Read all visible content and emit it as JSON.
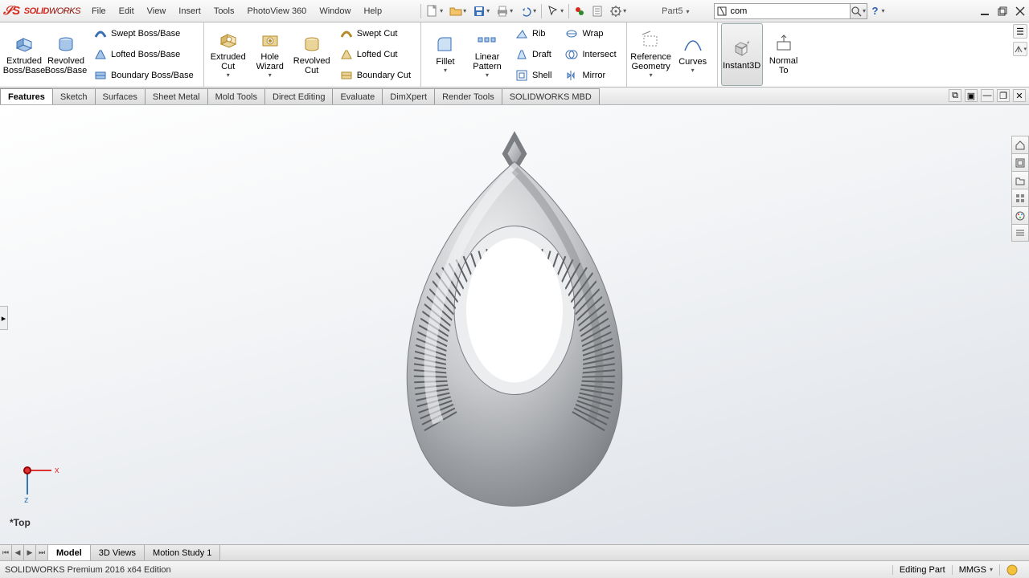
{
  "title": {
    "doc": "Part5",
    "search_value": "com"
  },
  "menus": [
    "File",
    "Edit",
    "View",
    "Insert",
    "Tools",
    "PhotoView 360",
    "Window",
    "Help"
  ],
  "ribbon": {
    "extruded_boss": "Extruded Boss/Base",
    "revolved_boss": "Revolved Boss/Base",
    "swept_boss": "Swept Boss/Base",
    "lofted_boss": "Lofted Boss/Base",
    "boundary_boss": "Boundary Boss/Base",
    "extruded_cut": "Extruded Cut",
    "hole_wizard": "Hole Wizard",
    "revolved_cut": "Revolved Cut",
    "swept_cut": "Swept Cut",
    "lofted_cut": "Lofted Cut",
    "boundary_cut": "Boundary Cut",
    "fillet": "Fillet",
    "linear_pattern": "Linear Pattern",
    "rib": "Rib",
    "draft": "Draft",
    "shell": "Shell",
    "wrap": "Wrap",
    "intersect": "Intersect",
    "mirror": "Mirror",
    "reference_geometry": "Reference Geometry",
    "curves": "Curves",
    "instant3d": "Instant3D",
    "normal_to": "Normal To"
  },
  "tabs": [
    "Features",
    "Sketch",
    "Surfaces",
    "Sheet Metal",
    "Mold Tools",
    "Direct Editing",
    "Evaluate",
    "DimXpert",
    "Render Tools",
    "SOLIDWORKS MBD"
  ],
  "bottom_tabs": [
    "Model",
    "3D Views",
    "Motion Study 1"
  ],
  "triad": "*Top",
  "status": {
    "left": "SOLIDWORKS Premium 2016 x64 Edition",
    "editing": "Editing Part",
    "units": "MMGS"
  }
}
